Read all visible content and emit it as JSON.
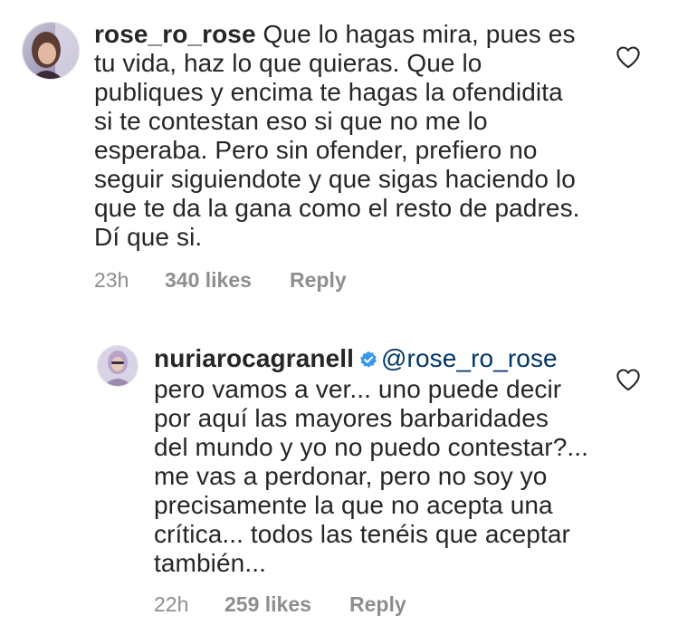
{
  "comments": [
    {
      "username": "rose_ro_rose",
      "text": "Que lo hagas mira, pues es tu vida, haz lo que quieras. Que lo publiques y encima te hagas la ofendidita si te contestan eso si que no me lo esperaba. Pero sin ofender, prefiero no seguir siguiendote y que sigas haciendo lo que te da la gana como el resto de padres. Dí que si.",
      "time": "23h",
      "likes": "340 likes",
      "reply_label": "Reply",
      "avatar_icon": "user-avatar-photo",
      "like_icon": "heart-outline-icon"
    },
    {
      "username": "nuriarocagranell",
      "verified": true,
      "mention": "@rose_ro_rose",
      "text": "pero vamos a ver... uno puede decir por aquí las mayores barbaridades del mundo y yo no puedo contestar?... me vas a perdonar, pero no soy yo precisamente la que no acepta una crítica... todos las tenéis que aceptar también...",
      "time": "22h",
      "likes": "259 likes",
      "reply_label": "Reply",
      "avatar_icon": "user-avatar-photo",
      "like_icon": "heart-outline-icon"
    }
  ],
  "colors": {
    "text": "#262626",
    "meta": "#8e8e8e",
    "mention": "#003569",
    "verified": "#3897f0"
  }
}
